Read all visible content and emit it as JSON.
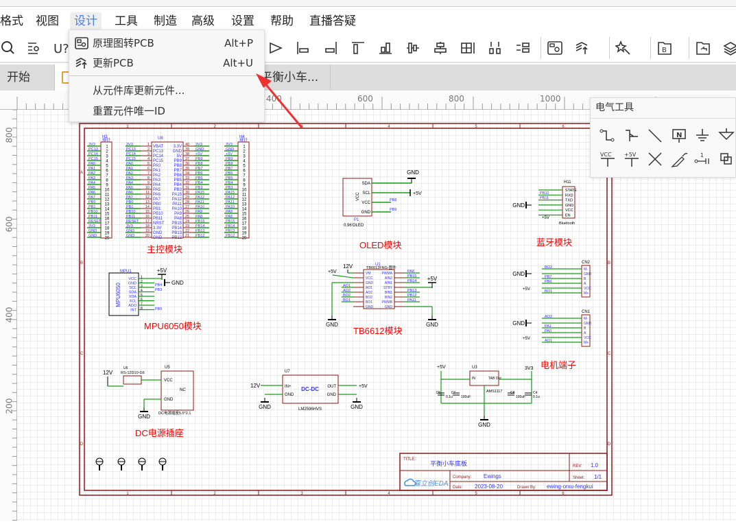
{
  "menu": {
    "items": [
      "格式",
      "视图",
      "设计",
      "工具",
      "制造",
      "高级",
      "设置",
      "帮助",
      "直播答疑"
    ],
    "active": "设计"
  },
  "toolbar": {
    "icons": [
      "search-icon",
      "find-list-icon",
      "unknown-component-icon",
      "flip-icon",
      "align-left-icon",
      "align-right-icon",
      "align-top-icon",
      "align-bottom-icon",
      "align-center-vertical-icon",
      "align-center-horizontal-icon",
      "distribute-grid-icon",
      "distribute-horizontal-icon",
      "distribute-vertical-icon",
      "schematic-to-pcb-icon",
      "update-pcb-icon",
      "magic-wand-icon",
      "bom-icon",
      "folder-back-icon",
      "layers-icon"
    ]
  },
  "tabs": [
    {
      "label": "开始"
    },
    {
      "label": ""
    },
    {
      "label": "平衡小车..."
    }
  ],
  "dropdown": {
    "items": [
      {
        "label": "原理图转PCB",
        "shortcut": "Alt+P",
        "icon": "schematic-to-pcb-icon"
      },
      {
        "label": "更新PCB",
        "shortcut": "Alt+U",
        "icon": "update-pcb-icon"
      },
      {
        "label": "从元件库更新元件...",
        "shortcut": ""
      },
      {
        "label": "重置元件唯一ID",
        "shortcut": ""
      }
    ]
  },
  "rulers": {
    "top": [
      "400",
      "600",
      "800",
      "1000"
    ],
    "left": [
      "800",
      "600",
      "400",
      "200"
    ]
  },
  "electrical_tools": {
    "title": "电气工具",
    "tools": [
      "wire-icon",
      "bus-icon",
      "line-icon",
      "net-label-icon",
      "ground-icon",
      "net-flag-icon",
      "vcc-icon",
      "plus5v-icon",
      "no-connect-icon",
      "probe-icon",
      "net-port-icon",
      "bus-entry-icon"
    ],
    "vcc_label": "VCC",
    "plus5v_label": "+5V",
    "net_label": "N"
  },
  "schematic": {
    "colors": {
      "frame": "#8b1a1a",
      "wire": "#1a9a1a",
      "pin": "#8b1a1a",
      "net": "#3333ff",
      "module_label": "#ff0000",
      "component": "#8b1a1a"
    },
    "columns": [
      "1",
      "2",
      "3",
      "4",
      "5",
      "6"
    ],
    "rows": [
      "A",
      "B",
      "C",
      "D"
    ],
    "module_labels": [
      "主控模块",
      "OLED模块",
      "蓝牙模块",
      "MPU6050模块",
      "TB6612模块",
      "电机端子",
      "DC电源插座"
    ],
    "h3": {
      "ref": "H3",
      "value": "排针",
      "nets": [
        "3V3",
        "PC13",
        "PC14",
        "PC15",
        "PA0",
        "PA1",
        "PA2",
        "PA3",
        "PA4",
        "PA5",
        "PA6",
        "PA7",
        "PB0",
        "PB1",
        "PB10",
        "PB11",
        "RESET",
        "3V3",
        "GND",
        "GND"
      ]
    },
    "u8": {
      "ref": "U8",
      "left": [
        "VBAT",
        "PC13",
        "PC14",
        "PC15",
        "PA0",
        "PA1",
        "PA2",
        "PA3",
        "PA4",
        "PA5",
        "PA6",
        "PA7",
        "PB0",
        "PB1",
        "PB10",
        "PB11",
        "NRST",
        "3.3V",
        "GND",
        "GND"
      ],
      "right": [
        "3.3V",
        "GND",
        "5V",
        "PB9",
        "PB8",
        "PB7",
        "PB6",
        "PB5",
        "PB4",
        "PB3",
        "PA15",
        "PA12",
        "PA11",
        "PA10",
        "PA9",
        "PA8",
        "PB15",
        "PB14",
        "PB13",
        "PB12"
      ],
      "right_nets": [
        "3V3",
        "GND",
        "+5V",
        "PB9",
        "PB8",
        "PB7",
        "PB6",
        "PB5",
        "PB4",
        "PB3",
        "PA15",
        "PA12",
        "PA11",
        "PA10",
        "PA9",
        "PA8",
        "PB15",
        "PB14",
        "PB13",
        "PB12"
      ]
    },
    "h4": {
      "ref": "H4",
      "value": "排针",
      "nets": [
        "3V3",
        "GND",
        "+5V",
        "PB9",
        "PB8",
        "PB7",
        "PB6",
        "PB5",
        "PB4",
        "PB3",
        "PA15",
        "PA12",
        "PA11",
        "PA10",
        "PA9",
        "PA8",
        "PB15",
        "PB14",
        "PB13",
        "PB12"
      ]
    },
    "oled": {
      "ref": "P1",
      "value": "0.96'OLED",
      "pins": [
        "SDA",
        "SCL",
        "VCC",
        "GND"
      ],
      "nets": [
        "PB8",
        "PB9"
      ],
      "gnd": "GND",
      "vcc": "+5V"
    },
    "bluetooth": {
      "ref": "H11",
      "value": "Bluetooth",
      "pins": [
        "STATE",
        "RXD",
        "TXD",
        "GND",
        "VCC",
        "EN"
      ],
      "nets": [
        "PB10",
        "PB11"
      ],
      "gnd": "GND",
      "vcc": "+5V"
    },
    "mpu": {
      "ref": "MPU1",
      "value": "MPU6050",
      "pins": [
        "VCC",
        "GND",
        "SCL",
        "SDA",
        "XDA",
        "XCL",
        "ADO",
        "INT"
      ],
      "nets": [
        "PB4",
        "PB3",
        "PB5"
      ],
      "vcc": "+5V",
      "gnd": "GND"
    },
    "tb6612": {
      "ref": "U1",
      "value": "TB6612FNG-图件",
      "left": [
        "VM",
        "VCC",
        "GND",
        "AO1",
        "AO2",
        "BO2",
        "BO1",
        "GND"
      ],
      "right": [
        "PWMA",
        "AIN2",
        "AIN1",
        "STBY",
        "BIN1",
        "BIN2",
        "PWMB",
        "GND"
      ],
      "left_nets": [
        "AO1",
        "AO2",
        "BO2",
        "BO1"
      ],
      "right_nets": [
        "PA8",
        "PB15",
        "PB14",
        "PB13",
        "PB12",
        "PA11"
      ],
      "v12": "12V",
      "v5": "+5V",
      "gnd": "GND"
    },
    "cn2": {
      "ref": "CN2",
      "pins": [
        "M-",
        "GND",
        "B",
        "A",
        "VCC",
        "M+"
      ],
      "nets": [
        "BO2",
        "PB7",
        "PB6",
        "BO1"
      ],
      "gnd": "GND",
      "vcc": "+5V"
    },
    "cn1": {
      "ref": "CN1",
      "pins": [
        "M-",
        "GND",
        "B",
        "A",
        "VCC",
        "M+"
      ],
      "nets": [
        "AO2",
        "PA1",
        "PA0",
        "AO1"
      ],
      "gnd": "GND",
      "vcc": "+5V"
    },
    "dc_jack": {
      "ref_switch": "U6",
      "switch": "RS-12D10-G6",
      "ref": "U5",
      "pins": [
        "VCC",
        "NC",
        "GND"
      ],
      "value": "DC电源插座5.5*2.1",
      "v12": "12V",
      "gnd": "GND"
    },
    "dcdc": {
      "ref": "U7",
      "value": "DC-DC",
      "part": "LM2596HVS",
      "pins": [
        "IN+",
        "GND",
        "OUT",
        "GND"
      ],
      "v12": "12V",
      "v5": "+5V",
      "gnd": "GND"
    },
    "ldo": {
      "ref": "U3",
      "value": "AMS1117",
      "pins": [
        "IN",
        "TAB Out",
        "GND"
      ],
      "v5": "+5V",
      "v33": "3V3",
      "gnd": "GND",
      "caps": [
        {
          "ref": "C5",
          "value": "0.1u"
        },
        {
          "ref": "C7",
          "value": "100uF"
        },
        {
          "ref": "C8",
          "value": "100uF"
        },
        {
          "ref": "C4",
          "value": "0.1u"
        }
      ]
    },
    "title_block": {
      "title_label": "TITLE:",
      "title": "平衡小车底板",
      "rev_label": "REV:",
      "rev": "1.0",
      "company_label": "Company:",
      "company": "Ewings",
      "sheet_label": "Sheet:",
      "sheet": "1/1",
      "date_label": "Date:",
      "date": "2023-08-20",
      "drawn_label": "Drawn By:",
      "drawn": "ewing-orxu-fengkui",
      "logo": "嘉立创EDA"
    }
  }
}
